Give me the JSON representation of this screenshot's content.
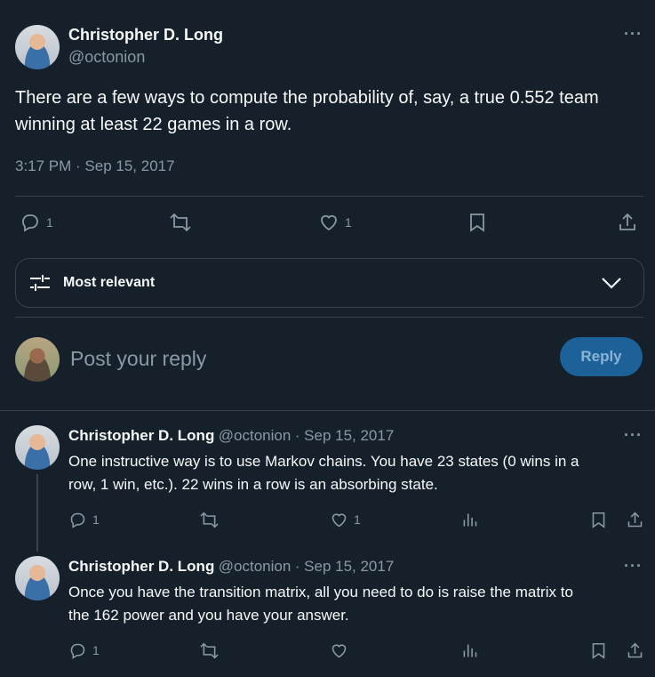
{
  "main_tweet": {
    "author_name": "Christopher D. Long",
    "author_handle": "@octonion",
    "text": "There are a few ways to compute the probability of, say, a true 0.552 team winning at least 22 games in a row.",
    "timestamp": "3:17 PM · Sep 15, 2017",
    "replies_count": "1",
    "likes_count": "1",
    "more_label": "···"
  },
  "filter": {
    "label": "Most relevant"
  },
  "composer": {
    "placeholder": "Post your reply",
    "reply_button": "Reply"
  },
  "replies": [
    {
      "author_name": "Christopher D. Long",
      "author_handle": "@octonion",
      "date": "· Sep 15, 2017",
      "text_line1": "One instructive way is to use Markov chains. You have 23 states (0 wins in a",
      "text_line2": "row, 1 win, etc.). 22 wins in a row is an absorbing state.",
      "replies_count": "1",
      "likes_count": "1",
      "more_label": "···"
    },
    {
      "author_name": "Christopher D. Long",
      "author_handle": "@octonion",
      "date": "· Sep 15, 2017",
      "text_line1": "Once you have the transition matrix, all you need to do is raise the matrix to",
      "text_line2": "the 162 power and you have your answer.",
      "replies_count": "1",
      "more_label": "···"
    }
  ],
  "colors": {
    "background": "#15202b",
    "text": "#f7f9f9",
    "muted": "#8b98a5",
    "divider": "#38444d",
    "reply_button": "#1d6199"
  }
}
